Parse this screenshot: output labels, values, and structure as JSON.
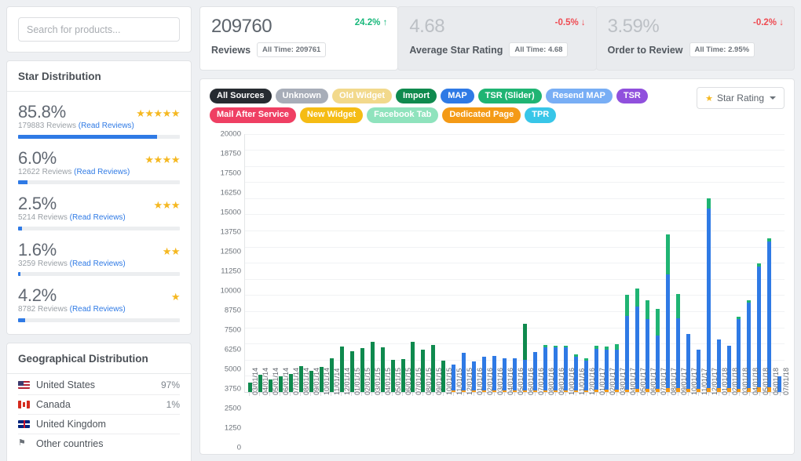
{
  "search": {
    "placeholder": "Search for products...",
    "value": ""
  },
  "star_distribution": {
    "title": "Star Distribution",
    "rows": [
      {
        "pct": "85.8%",
        "count": "179883",
        "reviews_word": "Reviews",
        "link": "(Read Reviews)",
        "stars": 5,
        "fill": 85.8
      },
      {
        "pct": "6.0%",
        "count": "12622",
        "reviews_word": "Reviews",
        "link": "(Read Reviews)",
        "stars": 4,
        "fill": 6.0
      },
      {
        "pct": "2.5%",
        "count": "5214",
        "reviews_word": "Reviews",
        "link": "(Read Reviews)",
        "stars": 3,
        "fill": 2.5
      },
      {
        "pct": "1.6%",
        "count": "3259",
        "reviews_word": "Reviews",
        "link": "(Read Reviews)",
        "stars": 2,
        "fill": 1.6
      },
      {
        "pct": "4.2%",
        "count": "8782",
        "reviews_word": "Reviews",
        "link": "(Read Reviews)",
        "stars": 1,
        "fill": 4.2
      }
    ]
  },
  "geographical_distribution": {
    "title": "Geographical Distribution",
    "rows": [
      {
        "flag": "us-flag-icon",
        "name": "United States",
        "value": "97%"
      },
      {
        "flag": "canada-flag-icon",
        "name": "Canada",
        "value": "1%"
      },
      {
        "flag": "uk-flag-icon",
        "name": "United Kingdom",
        "value": ""
      },
      {
        "flag": "generic-flag-icon",
        "name": "Other countries",
        "value": ""
      }
    ]
  },
  "stats": [
    {
      "value": "209760",
      "label": "Reviews",
      "chip": "All Time: 209761",
      "delta": "24.2% ↑",
      "direction": "up",
      "active": true
    },
    {
      "value": "4.68",
      "label": "Average Star Rating",
      "chip": "All Time: 4.68",
      "delta": "-0.5% ↓",
      "direction": "down",
      "active": false
    },
    {
      "value": "3.59%",
      "label": "Order to Review",
      "chip": "All Time: 2.95%",
      "delta": "-0.2% ↓",
      "direction": "down",
      "active": false
    }
  ],
  "source_filters": [
    {
      "label": "All Sources",
      "color": "#262b31",
      "active": true
    },
    {
      "label": "Unknown",
      "color": "#a7adb8"
    },
    {
      "label": "Old Widget",
      "color": "#f2d98c"
    },
    {
      "label": "Import",
      "color": "#0f8a4e"
    },
    {
      "label": "MAP",
      "color": "#2f7ae5"
    },
    {
      "label": "TSR (Slider)",
      "color": "#1fb473"
    },
    {
      "label": "Resend MAP",
      "color": "#78aef5"
    },
    {
      "label": "TSR",
      "color": "#9050dd"
    },
    {
      "label": "Mail After Service",
      "color": "#ef3f63"
    },
    {
      "label": "New Widget",
      "color": "#f5bc14"
    },
    {
      "label": "Facebook Tab",
      "color": "#8fe3bd"
    },
    {
      "label": "Dedicated Page",
      "color": "#f49a16"
    },
    {
      "label": "TPR",
      "color": "#38c6e8"
    }
  ],
  "star_rating_filter": {
    "label": "Star Rating",
    "icon": "star-icon"
  },
  "chart_data": {
    "type": "bar",
    "title": "",
    "xlabel": "",
    "ylabel": "",
    "ylim": [
      0,
      20000
    ],
    "y_ticks": [
      20000,
      18750,
      17500,
      16250,
      15000,
      13750,
      12500,
      11250,
      10000,
      8750,
      7500,
      6250,
      5000,
      3750,
      2500,
      1250,
      0
    ],
    "grid": true,
    "stacked": true,
    "legend_position": "top",
    "series": [
      {
        "name": "Dedicated Page",
        "color": "#f49a16"
      },
      {
        "name": "MAP",
        "color": "#2f7ae5"
      },
      {
        "name": "TSR (Slider)",
        "color": "#1fb473"
      },
      {
        "name": "Import",
        "color": "#0f8a4e"
      }
    ],
    "categories": [
      "03/01/14",
      "04/01/14",
      "05/01/14",
      "06/01/14",
      "07/01/14",
      "08/01/14",
      "09/01/14",
      "10/01/14",
      "11/01/14",
      "12/01/14",
      "01/01/15",
      "02/01/15",
      "03/01/15",
      "04/01/15",
      "05/01/15",
      "06/01/15",
      "07/01/15",
      "08/01/15",
      "09/01/15",
      "10/01/15",
      "11/01/15",
      "12/01/15",
      "01/01/16",
      "02/01/16",
      "03/01/16",
      "04/01/16",
      "05/01/16",
      "06/01/16",
      "07/01/16",
      "08/01/16",
      "09/01/16",
      "10/01/16",
      "11/01/16",
      "12/01/16",
      "01/01/17",
      "02/01/17",
      "03/01/17",
      "04/01/17",
      "05/01/17",
      "06/01/17",
      "07/01/17",
      "08/01/17",
      "09/01/17",
      "10/01/17",
      "11/01/17",
      "12/01/17",
      "01/01/18",
      "02/01/18",
      "03/01/18",
      "04/01/18",
      "05/01/18",
      "06/01/18",
      "07/01/18"
    ],
    "bars": [
      {
        "dedicated": 0,
        "map": 0,
        "tsr": 0,
        "import": 700
      },
      {
        "dedicated": 0,
        "map": 0,
        "tsr": 0,
        "import": 1350
      },
      {
        "dedicated": 0,
        "map": 0,
        "tsr": 0,
        "import": 1000
      },
      {
        "dedicated": 0,
        "map": 0,
        "tsr": 0,
        "import": 1200
      },
      {
        "dedicated": 0,
        "map": 0,
        "tsr": 0,
        "import": 1400
      },
      {
        "dedicated": 0,
        "map": 0,
        "tsr": 0,
        "import": 2000
      },
      {
        "dedicated": 0,
        "map": 0,
        "tsr": 0,
        "import": 1650
      },
      {
        "dedicated": 0,
        "map": 0,
        "tsr": 0,
        "import": 1950
      },
      {
        "dedicated": 0,
        "map": 0,
        "tsr": 0,
        "import": 2600
      },
      {
        "dedicated": 0,
        "map": 0,
        "tsr": 0,
        "import": 3550
      },
      {
        "dedicated": 0,
        "map": 0,
        "tsr": 0,
        "import": 3150
      },
      {
        "dedicated": 0,
        "map": 0,
        "tsr": 0,
        "import": 3400
      },
      {
        "dedicated": 0,
        "map": 0,
        "tsr": 0,
        "import": 3900
      },
      {
        "dedicated": 0,
        "map": 0,
        "tsr": 0,
        "import": 3450
      },
      {
        "dedicated": 0,
        "map": 0,
        "tsr": 0,
        "import": 2500
      },
      {
        "dedicated": 0,
        "map": 0,
        "tsr": 0,
        "import": 2550
      },
      {
        "dedicated": 0,
        "map": 0,
        "tsr": 0,
        "import": 3900
      },
      {
        "dedicated": 0,
        "map": 0,
        "tsr": 0,
        "import": 3300
      },
      {
        "dedicated": 0,
        "map": 0,
        "tsr": 0,
        "import": 3650
      },
      {
        "dedicated": 0,
        "map": 0,
        "tsr": 0,
        "import": 2450
      },
      {
        "dedicated": 100,
        "map": 2050,
        "tsr": 0,
        "import": 0
      },
      {
        "dedicated": 110,
        "map": 2900,
        "tsr": 0,
        "import": 0
      },
      {
        "dedicated": 110,
        "map": 2250,
        "tsr": 0,
        "import": 0
      },
      {
        "dedicated": 120,
        "map": 2600,
        "tsr": 0,
        "import": 0
      },
      {
        "dedicated": 120,
        "map": 2650,
        "tsr": 0,
        "import": 0
      },
      {
        "dedicated": 120,
        "map": 2500,
        "tsr": 0,
        "import": 0
      },
      {
        "dedicated": 120,
        "map": 2500,
        "tsr": 0,
        "import": 0
      },
      {
        "dedicated": 130,
        "map": 2350,
        "tsr": 0,
        "import": 2800
      },
      {
        "dedicated": 130,
        "map": 2980,
        "tsr": 0,
        "import": 0
      },
      {
        "dedicated": 140,
        "map": 3350,
        "tsr": 150,
        "import": 0
      },
      {
        "dedicated": 140,
        "map": 3300,
        "tsr": 150,
        "import": 0
      },
      {
        "dedicated": 140,
        "map": 3300,
        "tsr": 150,
        "import": 0
      },
      {
        "dedicated": 150,
        "map": 2600,
        "tsr": 150,
        "import": 0
      },
      {
        "dedicated": 150,
        "map": 2300,
        "tsr": 150,
        "import": 0
      },
      {
        "dedicated": 160,
        "map": 3150,
        "tsr": 300,
        "import": 0
      },
      {
        "dedicated": 170,
        "map": 3100,
        "tsr": 250,
        "import": 0
      },
      {
        "dedicated": 180,
        "map": 3100,
        "tsr": 400,
        "import": 0
      },
      {
        "dedicated": 200,
        "map": 5700,
        "tsr": 1600,
        "import": 0
      },
      {
        "dedicated": 220,
        "map": 6400,
        "tsr": 1400,
        "import": 0
      },
      {
        "dedicated": 230,
        "map": 5400,
        "tsr": 1450,
        "import": 0
      },
      {
        "dedicated": 260,
        "map": 4100,
        "tsr": 2100,
        "import": 0
      },
      {
        "dedicated": 280,
        "map": 8800,
        "tsr": 3100,
        "import": 0
      },
      {
        "dedicated": 280,
        "map": 5400,
        "tsr": 1900,
        "import": 0
      },
      {
        "dedicated": 260,
        "map": 4250,
        "tsr": 0,
        "import": 0
      },
      {
        "dedicated": 250,
        "map": 3000,
        "tsr": 0,
        "import": 0
      },
      {
        "dedicated": 300,
        "map": 13900,
        "tsr": 800,
        "import": 0
      },
      {
        "dedicated": 280,
        "map": 3800,
        "tsr": 0,
        "import": 0
      },
      {
        "dedicated": 280,
        "map": 3300,
        "tsr": 0,
        "import": 0
      },
      {
        "dedicated": 270,
        "map": 5400,
        "tsr": 170,
        "import": 0
      },
      {
        "dedicated": 330,
        "map": 6600,
        "tsr": 180,
        "import": 0
      },
      {
        "dedicated": 340,
        "map": 9400,
        "tsr": 200,
        "import": 0
      },
      {
        "dedicated": 350,
        "map": 11300,
        "tsr": 250,
        "import": 0
      },
      {
        "dedicated": 0,
        "map": 1200,
        "tsr": 0,
        "import": 0
      }
    ]
  }
}
